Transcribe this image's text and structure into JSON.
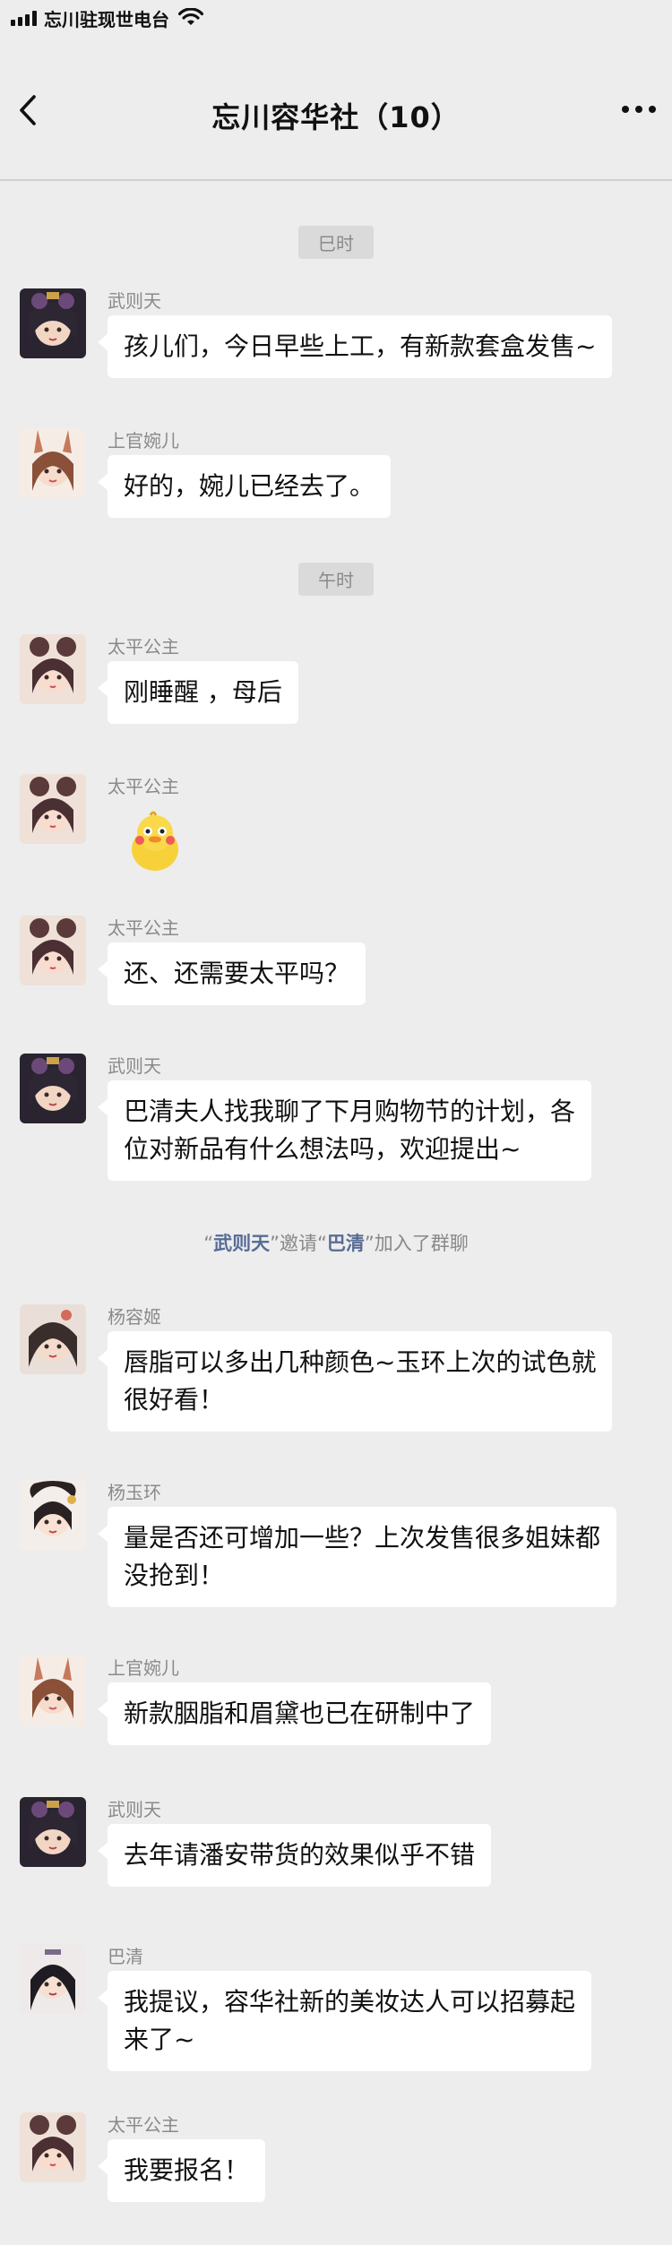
{
  "status_bar": {
    "carrier": "忘川驻现世电台"
  },
  "nav": {
    "title": "忘川容华社（10）"
  },
  "time_labels": {
    "si": "巳时",
    "wu": "午时"
  },
  "system_notice": {
    "q1": "“",
    "inviter": "武则天",
    "q2": "”邀请“",
    "invitee": "巴清",
    "q3": "”加入了群聊"
  },
  "messages": [
    {
      "sender": "武则天",
      "text": "孩儿们，今日早些上工，有新款套盒发售~",
      "avatar": "wuzetian"
    },
    {
      "sender": "上官婉儿",
      "text": "好的，婉儿已经去了。",
      "avatar": "wan-er"
    },
    {
      "sender": "太平公主",
      "text": "刚睡醒 ，母后",
      "avatar": "taiping"
    },
    {
      "sender": "太平公主",
      "text": "",
      "sticker": "duck-sticker",
      "avatar": "taiping"
    },
    {
      "sender": "太平公主",
      "text": "还、还需要太平吗？",
      "avatar": "taiping"
    },
    {
      "sender": "武则天",
      "text_lines": [
        "巴清夫人找我聊了下月购物节的计划，各",
        "位对新品有什么想法吗，欢迎提出~"
      ],
      "avatar": "wuzetian"
    },
    {
      "sender": "杨容姬",
      "text_lines": [
        "唇脂可以多出几种颜色~玉环上次的试色就",
        "很好看！"
      ],
      "avatar": "yangrongji"
    },
    {
      "sender": "杨玉环",
      "text_lines": [
        "量是否还可增加一些？上次发售很多姐妹都",
        "没抢到！"
      ],
      "avatar": "yangyuhuan"
    },
    {
      "sender": "上官婉儿",
      "text": "新款胭脂和眉黛也已在研制中了",
      "avatar": "wan-er"
    },
    {
      "sender": "武则天",
      "text": "去年请潘安带货的效果似乎不错",
      "avatar": "wuzetian"
    },
    {
      "sender": "巴清",
      "text_lines": [
        "我提议，容华社新的美妆达人可以招募起",
        "来了~"
      ],
      "avatar": "baqing"
    },
    {
      "sender": "太平公主",
      "text": "我要报名！",
      "avatar": "taiping"
    }
  ],
  "colors": {
    "background": "#ededed",
    "bubble": "#ffffff",
    "link": "#576b95"
  }
}
